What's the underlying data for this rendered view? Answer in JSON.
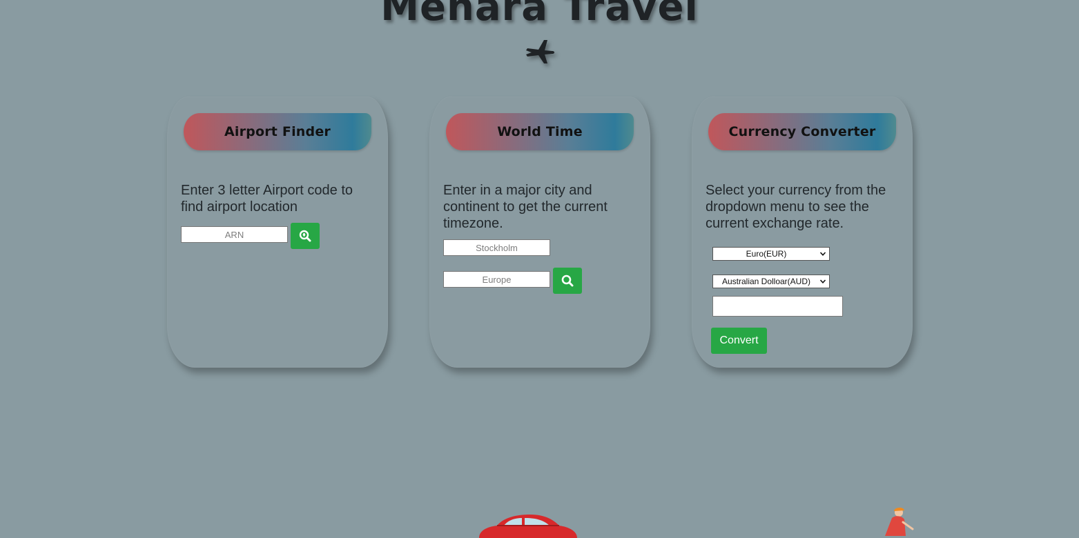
{
  "header": {
    "title": "Menara Travel",
    "icon": "plane-icon"
  },
  "cards": {
    "airport": {
      "title": "Airport Finder",
      "description": "Enter 3 letter Airport code to find airport location",
      "code_placeholder": "ARN",
      "search_icon": "search-location-icon"
    },
    "worldtime": {
      "title": "World Time",
      "description": "Enter in a major city and continent to get the current timezone.",
      "city_placeholder": "Stockholm",
      "continent_placeholder": "Europe",
      "search_icon": "search-icon"
    },
    "currency": {
      "title": "Currency Converter",
      "description": "Select your currency from the dropdown menu to see the current exchange rate.",
      "from_currency": "Euro(EUR)",
      "to_currency": "Australian Dolloar(AUD)",
      "amount_value": "",
      "convert_label": "Convert"
    }
  },
  "colors": {
    "background": "#899ba1",
    "button_green": "#27a745",
    "header_gradient_start": "#c0575b",
    "header_gradient_end": "#2f7b9b"
  },
  "decorations": {
    "car_icon": "red-car-icon",
    "cyclist_icon": "cyclist-icon"
  }
}
